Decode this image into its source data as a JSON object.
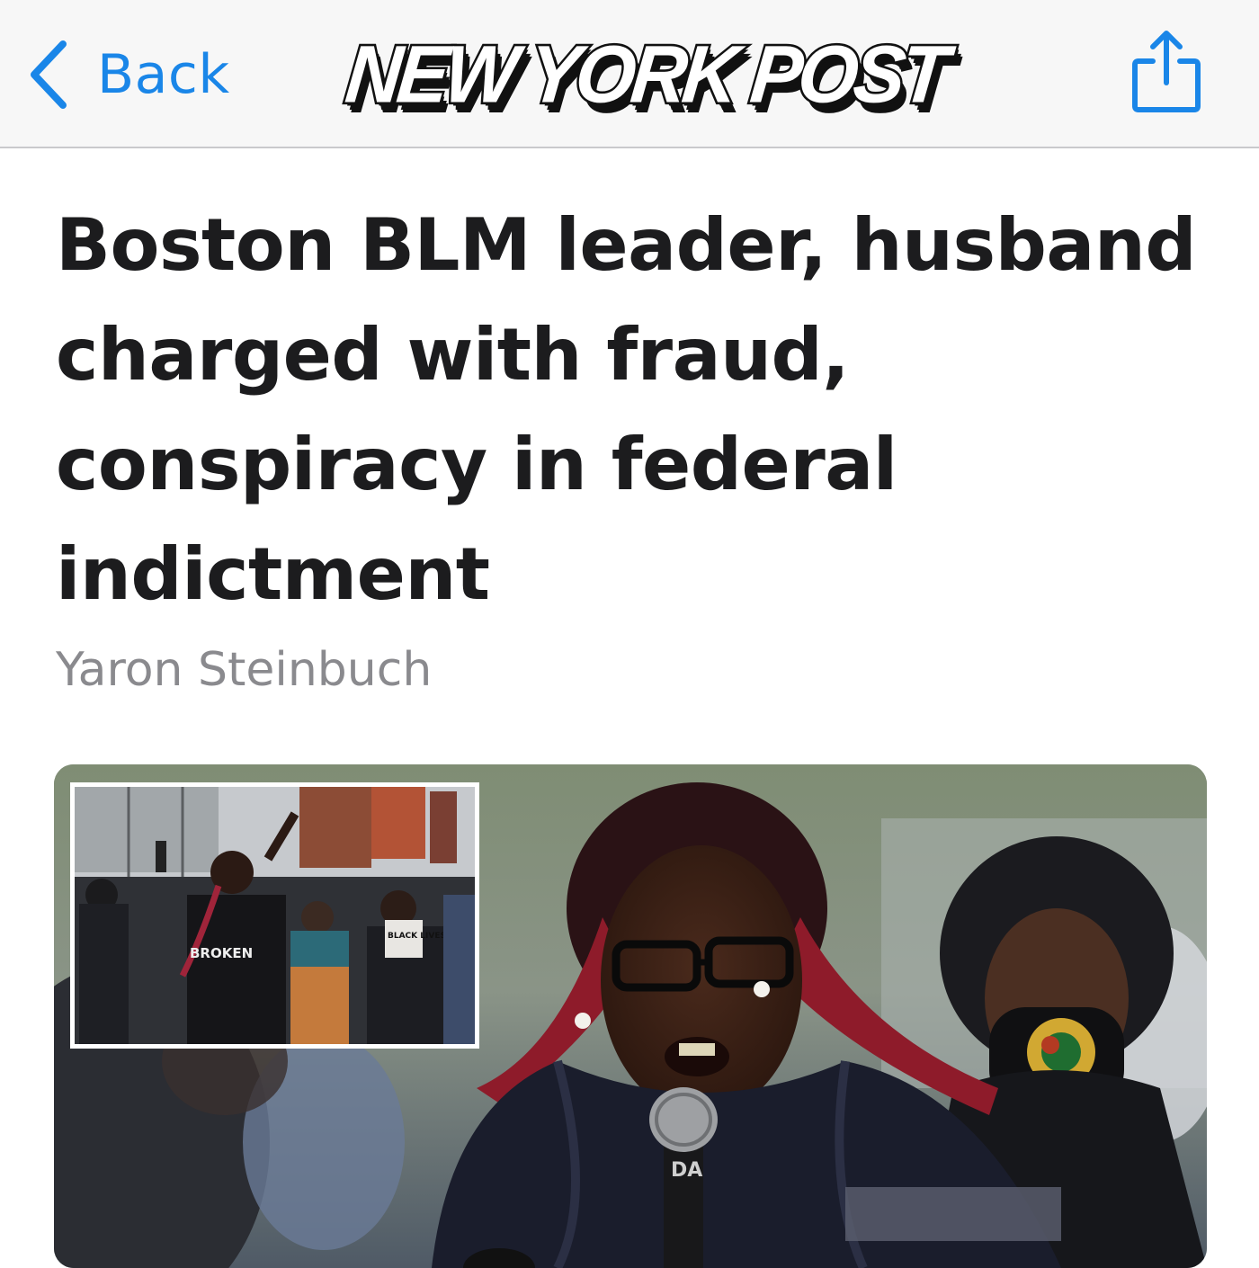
{
  "navbar": {
    "back_label": "Back",
    "masthead": "NEW YORK POST",
    "accent_color": "#1a86e8",
    "back_icon": "chevron-left-icon",
    "share_icon": "share-icon"
  },
  "article": {
    "headline": "Boston BLM leader, husband charged with fraud, conspiracy in federal indictment",
    "author": "Yaron Steinbuch"
  },
  "photo": {
    "inset_shirt_text": "BROKEN",
    "inset_sign_text": "BLACK LIVES MATTER",
    "mic_text": "DA"
  }
}
